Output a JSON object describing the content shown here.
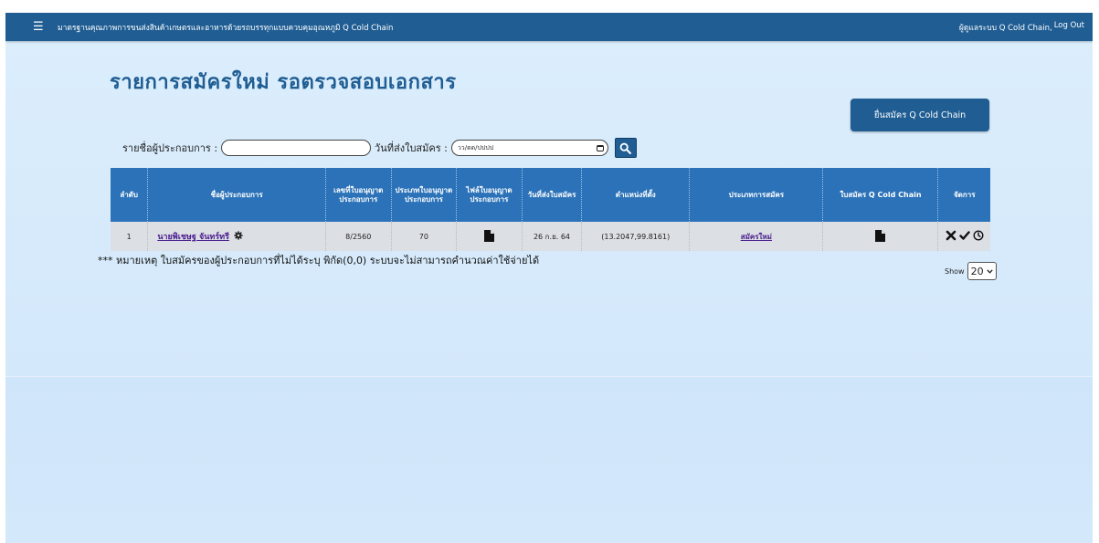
{
  "navbar": {
    "menu_icon": "hamburger-icon",
    "title": "มาตรฐานคุณภาพการขนส่งสินค้าเกษตรและอาหารด้วยรถบรรทุกแบบควบคุมอุณหภูมิ Q Cold Chain",
    "user_label": "ผู้ดูแลระบบ Q Cold Chain,",
    "logout_label": "Log Out"
  },
  "page": {
    "title": "รายการสมัครใหม่ รอตรวจสอบเอกสาร",
    "apply_button": "ยื่นสมัคร Q Cold Chain"
  },
  "filters": {
    "operator_name_label": "รายชื่อผู้ประกอบการ :",
    "operator_name_value": "",
    "submit_date_label": "วันที่ส่งใบสมัคร :",
    "submit_date_placeholder": "วว/ดด/ปปปป",
    "search_icon": "search-icon",
    "calendar_icon": "calendar-icon"
  },
  "table": {
    "headers": [
      "ลำดับ",
      "ชื่อผู้ประกอบการ",
      "เลขที่ใบอนุญาตประกอบการ",
      "ประเภทใบอนุญาตประกอบการ",
      "ไฟล์ใบอนุญาตประกอบการ",
      "วันที่ส่งใบสมัคร",
      "ตำแหน่งที่ตั้ง",
      "ประเภทการสมัคร",
      "ใบสมัคร Q Cold Chain",
      "จัดการ"
    ],
    "rows": [
      {
        "index": "1",
        "operator_name": "นายพิเชษฐ จันทร์ทรี",
        "license_no": "8/2560",
        "license_type": "70",
        "license_file_icon": "document-icon",
        "submit_date": "26 ก.ย. 64",
        "location": "(13.2047,99.8161)",
        "apply_type": "สมัครใหม่",
        "application_icon": "document-icon",
        "actions": [
          "reject-icon",
          "approve-icon",
          "history-icon"
        ]
      }
    ]
  },
  "note": "*** หมายเหตุ ใบสมัครของผู้ประกอบการที่ไม่ได้ระบุ พิกัด(0,0) ระบบจะไม่สามารถคำนวณค่าใช้จ่ายได้",
  "pagination": {
    "show_label": "Show",
    "page_size": "20"
  },
  "colors": {
    "navbar": "#1f5d93",
    "table_header": "#2b72b8",
    "title": "#1f5d93",
    "link": "#4b1d8f"
  }
}
